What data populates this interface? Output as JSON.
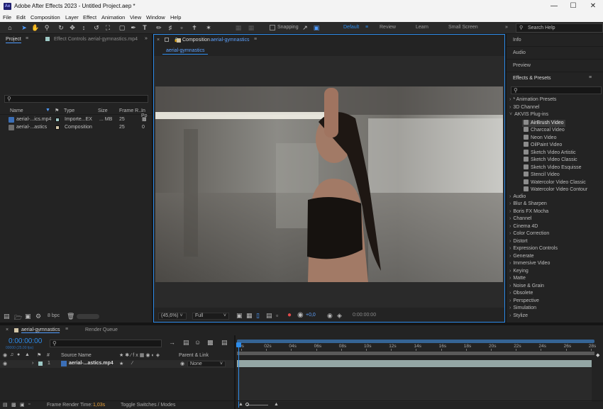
{
  "window": {
    "app_icon": "Ae",
    "title": "Adobe After Effects 2023 - Untitled Project.aep *",
    "controls": [
      "minimize",
      "maximize",
      "close"
    ]
  },
  "menu": [
    "File",
    "Edit",
    "Composition",
    "Layer",
    "Effect",
    "Animation",
    "View",
    "Window",
    "Help"
  ],
  "toolbar": {
    "snapping_label": "Snapping",
    "workspaces": [
      "Default",
      "Review",
      "Learn",
      "Small Screen"
    ],
    "active_workspace": "Default",
    "search_help_placeholder": "Search Help"
  },
  "project_panel": {
    "tab_project": "Project",
    "tab_effect_controls": "Effect Controls",
    "effect_controls_target": "aerial-gymnastics.mp4",
    "search_placeholder": "",
    "columns": [
      "Name",
      "Type",
      "Size",
      "Frame R...",
      "In Po"
    ],
    "items": [
      {
        "name": "aerial-...ics.mp4",
        "type": "Importe...EX",
        "size": "... MB",
        "frame_rate": "25",
        "color": "#9ec9c6",
        "icon": "footage-icon"
      },
      {
        "name": "aerial-...astics",
        "type": "Composition",
        "size": "",
        "frame_rate": "25",
        "color": "#d4c7a8",
        "icon": "composition-icon"
      }
    ],
    "bpc": "8 bpc"
  },
  "composition_panel": {
    "tab_prefix": "Composition",
    "comp_name": "aerial-gymnastics",
    "breadcrumb": "aerial-gymnastics",
    "zoom": "(45,6%)",
    "resolution": "Full",
    "exposure": "+0,0",
    "timecode": "0:00:00:00"
  },
  "right_panels": {
    "info": "Info",
    "audio": "Audio",
    "preview": "Preview",
    "effects_presets": "Effects & Presets",
    "categories": [
      {
        "label": "* Animation Presets",
        "expanded": false
      },
      {
        "label": "3D Channel",
        "expanded": false
      },
      {
        "label": "AKVIS Plug-ins",
        "expanded": true,
        "children": [
          "AirBrush Video",
          "Charcoal Video",
          "Neon Video",
          "OilPaint Video",
          "Sketch Video Artistic",
          "Sketch Video Classic",
          "Sketch Video Esquisse",
          "Stencil Video",
          "Watercolor Video Classic",
          "Watercolor Video Contour"
        ]
      },
      {
        "label": "Audio",
        "expanded": false
      },
      {
        "label": "Blur & Sharpen",
        "expanded": false
      },
      {
        "label": "Boris FX Mocha",
        "expanded": false
      },
      {
        "label": "Channel",
        "expanded": false
      },
      {
        "label": "Cinema 4D",
        "expanded": false
      },
      {
        "label": "Color Correction",
        "expanded": false
      },
      {
        "label": "Distort",
        "expanded": false
      },
      {
        "label": "Expression Controls",
        "expanded": false
      },
      {
        "label": "Generate",
        "expanded": false
      },
      {
        "label": "Immersive Video",
        "expanded": false
      },
      {
        "label": "Keying",
        "expanded": false
      },
      {
        "label": "Matte",
        "expanded": false
      },
      {
        "label": "Noise & Grain",
        "expanded": false
      },
      {
        "label": "Obsolete",
        "expanded": false
      },
      {
        "label": "Perspective",
        "expanded": false
      },
      {
        "label": "Simulation",
        "expanded": false
      },
      {
        "label": "Stylize",
        "expanded": false
      }
    ],
    "selected_effect": "AirBrush Video"
  },
  "timeline": {
    "tab_comp": "aerial-gymnastics",
    "tab_render": "Render Queue",
    "timecode": "0:00:00:00",
    "timecode_sub": "00000 (25.00 fps)",
    "columns": {
      "num": "#",
      "source_name": "Source Name",
      "parent": "Parent & Link"
    },
    "layers": [
      {
        "num": "1",
        "name": "aerial-...astics.mp4",
        "parent": "None"
      }
    ],
    "ruler": [
      "0s",
      "02s",
      "04s",
      "06s",
      "08s",
      "10s",
      "12s",
      "14s",
      "16s",
      "18s",
      "20s",
      "22s",
      "24s",
      "26s",
      "28s"
    ],
    "footer_render_label": "Frame Render Time:",
    "footer_render_value": "1,03s",
    "footer_toggle": "Toggle Switches / Modes"
  },
  "colors": {
    "accent": "#2d8ceb",
    "panel": "#232323",
    "layer_bar": "#93a6a4"
  }
}
